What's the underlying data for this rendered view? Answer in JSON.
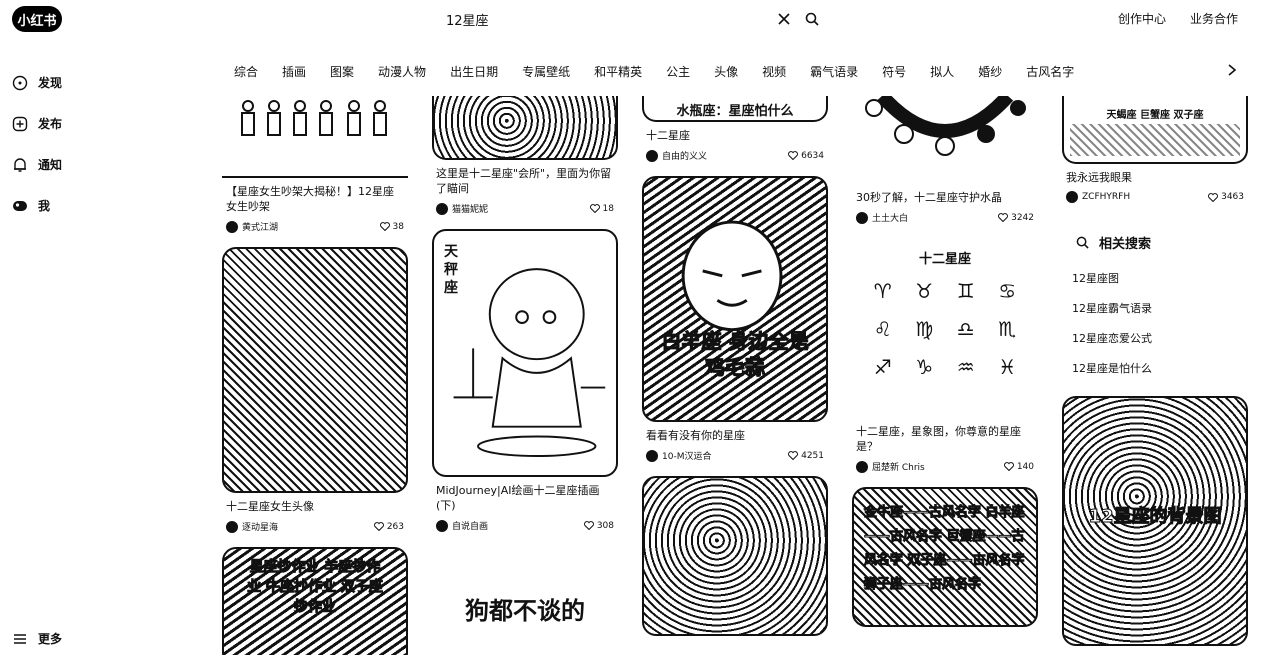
{
  "app": {
    "logo": "小红书"
  },
  "search": {
    "query": "12星座"
  },
  "top_links": [
    "创作中心",
    "业务合作"
  ],
  "sidebar": {
    "items": [
      {
        "label": "发现",
        "icon": "compass-icon"
      },
      {
        "label": "发布",
        "icon": "plus-icon"
      },
      {
        "label": "通知",
        "icon": "bell-icon"
      },
      {
        "label": "我",
        "icon": "avatar-icon"
      }
    ],
    "more": "更多"
  },
  "tabs": [
    "综合",
    "插画",
    "图案",
    "动漫人物",
    "出生日期",
    "专属壁纸",
    "和平精英",
    "公主",
    "头像",
    "视频",
    "霸气语录",
    "符号",
    "拟人",
    "婚纱",
    "古风名字"
  ],
  "feed": {
    "col1": [
      {
        "caption": "【星座女生吵架大揭秘！】12星座女生吵架",
        "author": "黄式江湖",
        "likes": "38",
        "img_text": ""
      },
      {
        "caption": "十二星座女生头像",
        "author": "逐动星海",
        "likes": "263",
        "img_text": ""
      },
      {
        "caption": "",
        "author": "",
        "likes": "",
        "img_text": "星座抄作业 羊座抄作业 牛座抄作业 双子座抄作业"
      }
    ],
    "col2": [
      {
        "caption": "这里是十二星座\"会所\"，里面为你留了瞄间",
        "author": "猫猫妮妮",
        "likes": "18",
        "img_text": ""
      },
      {
        "caption": "MidJourney|AI绘画十二星座插画(下)",
        "author": "自说自画",
        "likes": "308",
        "img_text": "天秤座"
      },
      {
        "caption": "",
        "author": "",
        "likes": "",
        "img_text": "狗都不谈的"
      }
    ],
    "col3": [
      {
        "caption": "十二星座",
        "author": "自由的义义",
        "likes": "6634",
        "img_text": "水瓶座：星座怕什么"
      },
      {
        "caption": "看看有没有你的星座",
        "author": "10-M汉运合",
        "likes": "4251",
        "img_text": "白羊座 身边全是鸡毛蒜"
      },
      {
        "caption": "",
        "author": "",
        "likes": "",
        "img_text": ""
      }
    ],
    "col4": [
      {
        "caption": "30秒了解，十二星座守护水晶",
        "author": "土土大白",
        "likes": "3242",
        "img_text": ""
      },
      {
        "caption": "十二星座，星象图，你尊意的星座是？",
        "author": "屈楚新 Chris",
        "likes": "140",
        "img_text": "十二星座"
      },
      {
        "caption": "",
        "author": "",
        "likes": "",
        "img_text": "金牛座——古风名字 白羊座——古风名字 巨蟹座——古风名字 双子座——古风名字 狮子座——古风名字"
      }
    ],
    "col5": [
      {
        "caption": "我永远我眼果",
        "author": "ZCFHYRFH",
        "likes": "3463",
        "img_text": "天蝎座 巨蟹座 双子座"
      },
      {
        "caption": "",
        "author": "",
        "likes": "",
        "img_text": "12星座的背景图"
      }
    ]
  },
  "related": {
    "title": "相关搜索",
    "items": [
      "12星座图",
      "12星座霸气语录",
      "12星座恋爱公式",
      "12星座是怕什么"
    ]
  },
  "zodiac_symbols": [
    "♈",
    "♉",
    "♊",
    "♋",
    "♌",
    "♍",
    "♎",
    "♏",
    "♐",
    "♑",
    "♒",
    "♓"
  ]
}
